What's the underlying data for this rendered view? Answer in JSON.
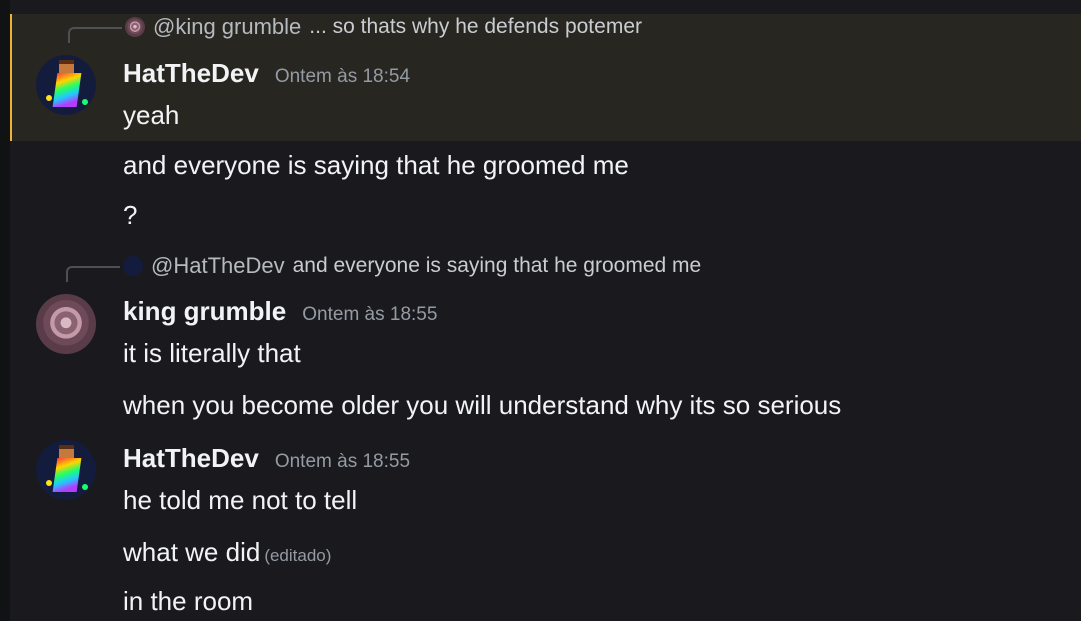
{
  "messages": [
    {
      "reply": {
        "author": "@king grumble",
        "text": "... so thats why he defends potemer"
      },
      "author": "HatTheDev",
      "timestamp": "Ontem às 18:54",
      "lines": [
        "yeah",
        "and everyone is saying that he groomed me",
        "?"
      ]
    },
    {
      "reply": {
        "author": "@HatTheDev",
        "text": "and everyone is saying that he groomed me"
      },
      "author": "king grumble",
      "timestamp": "Ontem às 18:55",
      "lines": [
        "it is literally that",
        "when you become older you will understand why its so serious"
      ]
    },
    {
      "author": "HatTheDev",
      "timestamp": "Ontem às 18:55",
      "lines": [
        "he told me not to tell",
        "what we did",
        "in the room"
      ],
      "edited_label": "(editado)"
    }
  ],
  "colors": {
    "background": "#1a1a1e",
    "highlight_bg": "#282620",
    "highlight_border": "#f0b232",
    "timestamp": "#949ba4"
  }
}
